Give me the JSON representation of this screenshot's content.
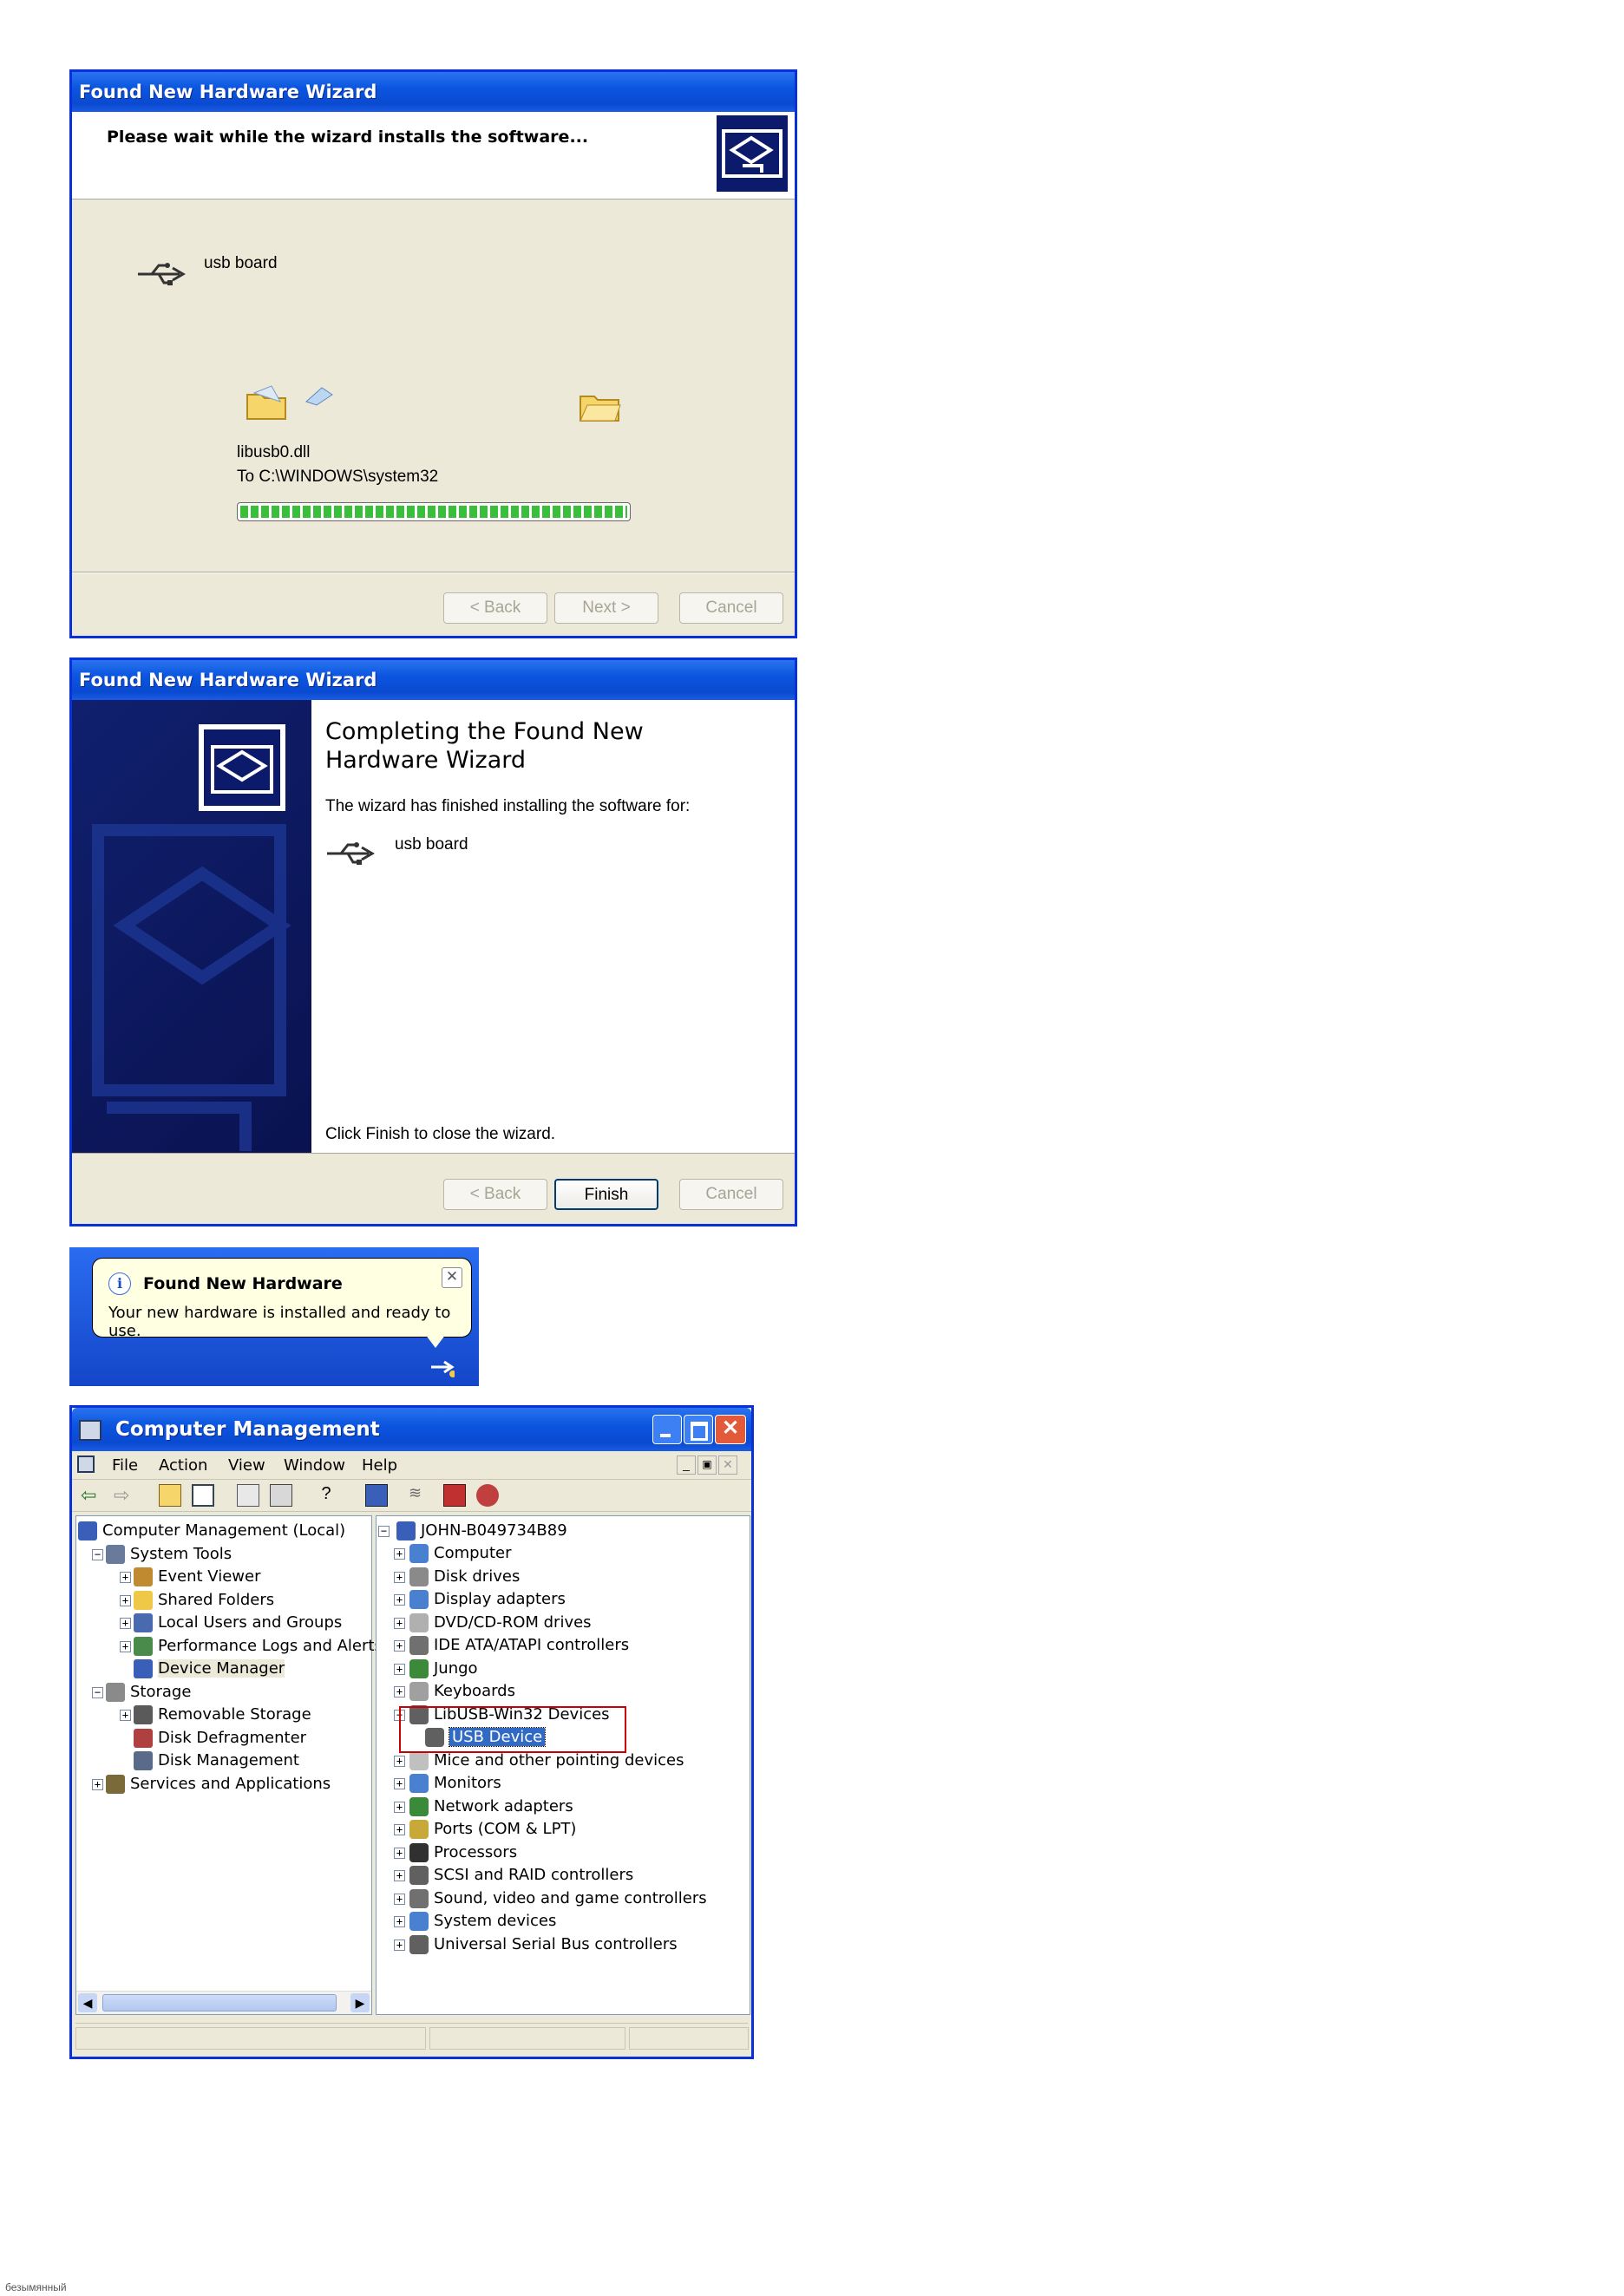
{
  "wizard1": {
    "title": "Found New Hardware Wizard",
    "heading": "Please wait while the wizard installs the software...",
    "device": "usb board",
    "file": "libusb0.dll",
    "destination": "To C:\\WINDOWS\\system32",
    "progress": 1.0,
    "back": "< Back",
    "next": "Next >",
    "cancel": "Cancel"
  },
  "wizard2": {
    "title": "Found New Hardware Wizard",
    "heading": "Completing the Found New Hardware Wizard",
    "message": "The wizard has finished installing the software for:",
    "device": "usb board",
    "footer": "Click Finish to close the wizard.",
    "back": "< Back",
    "finish": "Finish",
    "cancel": "Cancel"
  },
  "balloon": {
    "title": "Found New Hardware",
    "message": "Your new hardware is installed and ready to use."
  },
  "compmgmt": {
    "title": "Computer Management",
    "menu": [
      "File",
      "Action",
      "View",
      "Window",
      "Help"
    ],
    "left_tree": [
      {
        "label": "Computer Management (Local)",
        "level": 0,
        "icon": "computer-icon"
      },
      {
        "label": "System Tools",
        "level": 1,
        "icon": "tools-icon"
      },
      {
        "label": "Event Viewer",
        "level": 2,
        "icon": "event-viewer-icon"
      },
      {
        "label": "Shared Folders",
        "level": 2,
        "icon": "folder-icon"
      },
      {
        "label": "Local Users and Groups",
        "level": 2,
        "icon": "users-icon"
      },
      {
        "label": "Performance Logs and Alerts",
        "level": 2,
        "icon": "perf-icon"
      },
      {
        "label": "Device Manager",
        "level": 2,
        "icon": "device-manager-icon"
      },
      {
        "label": "Storage",
        "level": 1,
        "icon": "storage-icon"
      },
      {
        "label": "Removable Storage",
        "level": 2,
        "icon": "removable-icon"
      },
      {
        "label": "Disk Defragmenter",
        "level": 2,
        "icon": "defrag-icon"
      },
      {
        "label": "Disk Management",
        "level": 2,
        "icon": "disk-icon"
      },
      {
        "label": "Services and Applications",
        "level": 1,
        "icon": "services-icon"
      }
    ],
    "right_root": "JOHN-B049734B89",
    "right_tree": [
      "Computer",
      "Disk drives",
      "Display adapters",
      "DVD/CD-ROM drives",
      "IDE ATA/ATAPI controllers",
      "Jungo",
      "Keyboards",
      "LibUSB-Win32 Devices",
      "USB Device",
      "Mice and other pointing devices",
      "Monitors",
      "Network adapters",
      "Ports (COM & LPT)",
      "Processors",
      "SCSI and RAID controllers",
      "Sound, video and game controllers",
      "System devices",
      "Universal Serial Bus controllers"
    ],
    "highlight_color": "#cc0000",
    "selection_color": "#316ac5"
  },
  "footer_text": "безымянный"
}
